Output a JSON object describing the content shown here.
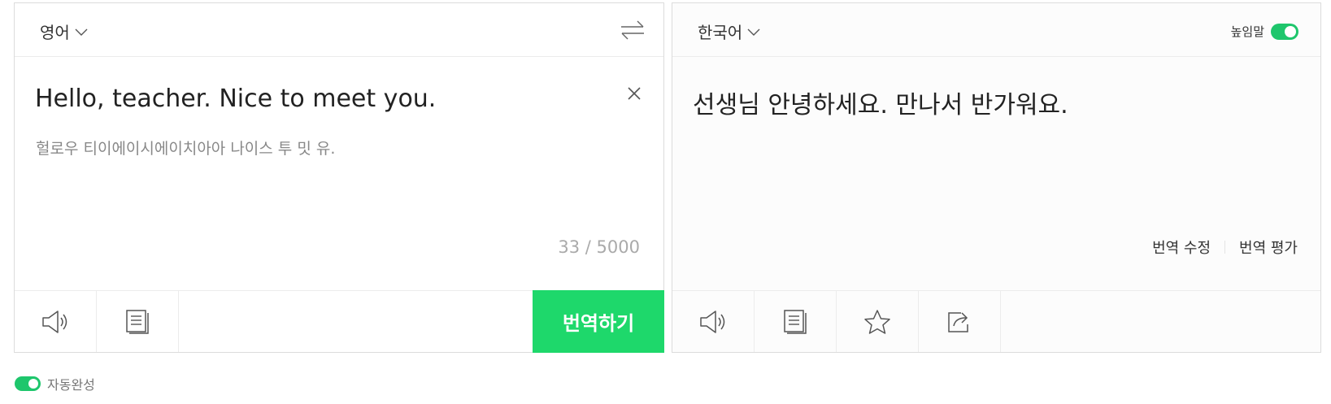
{
  "source": {
    "language": "영어",
    "text": "Hello, teacher. Nice to meet you.",
    "pronunciation": "헐로우 티이에이시에이치아아 나이스 투 밋 유.",
    "char_count": "33 / 5000",
    "translate_label": "번역하기",
    "icons": [
      "speaker-icon",
      "copy-icon",
      "swap-icon",
      "close-icon",
      "chevron-down-icon"
    ]
  },
  "target": {
    "language": "한국어",
    "honorific_label": "높임말",
    "honorific_on": true,
    "text": "선생님 안녕하세요. 만나서 반가워요.",
    "edit_label": "번역 수정",
    "rate_label": "번역 평가",
    "icons": [
      "speaker-icon",
      "copy-icon",
      "star-icon",
      "share-icon",
      "chevron-down-icon"
    ]
  },
  "autocomplete": {
    "label": "자동완성",
    "on": true
  },
  "colors": {
    "accent": "#1ed86b",
    "toggle": "#1ec66c",
    "border": "#dcdcdc"
  }
}
